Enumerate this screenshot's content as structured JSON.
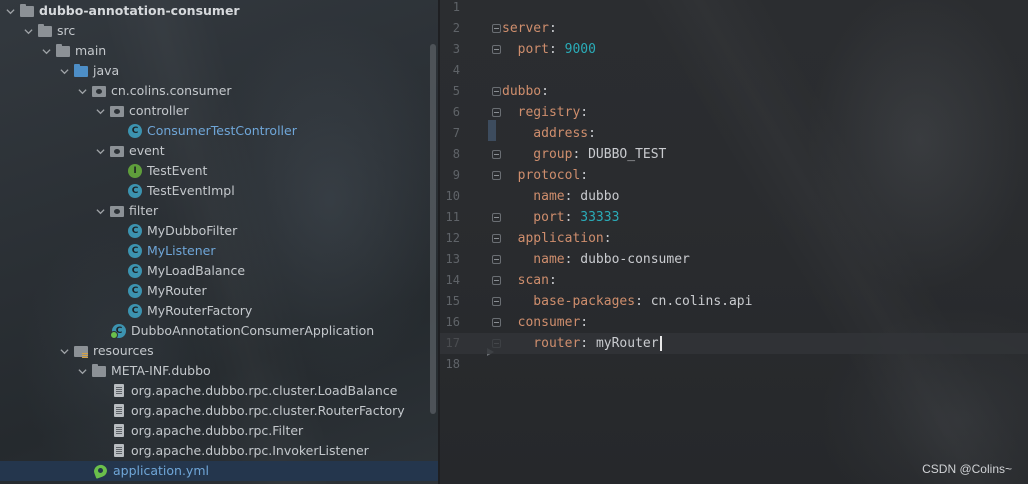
{
  "tree": {
    "items": [
      {
        "label": "dubbo-annotation-consumer",
        "icon": "folder-icon",
        "bold": true,
        "expanded": true
      },
      {
        "label": "src",
        "icon": "folder-icon",
        "expanded": true
      },
      {
        "label": "main",
        "icon": "folder-icon",
        "expanded": true
      },
      {
        "label": "java",
        "icon": "source-folder-icon",
        "expanded": true
      },
      {
        "label": "cn.colins.consumer",
        "icon": "package-icon",
        "expanded": true
      },
      {
        "label": "controller",
        "icon": "package-icon",
        "expanded": true
      },
      {
        "label": "ConsumerTestController",
        "icon": "class-icon",
        "glyph": "C"
      },
      {
        "label": "event",
        "icon": "package-icon",
        "expanded": true
      },
      {
        "label": "TestEvent",
        "icon": "interface-icon",
        "glyph": "I"
      },
      {
        "label": "TestEventImpl",
        "icon": "class-icon",
        "glyph": "C"
      },
      {
        "label": "filter",
        "icon": "package-icon",
        "expanded": true
      },
      {
        "label": "MyDubboFilter",
        "icon": "class-icon",
        "glyph": "C"
      },
      {
        "label": "MyListener",
        "icon": "class-icon",
        "glyph": "C"
      },
      {
        "label": "MyLoadBalance",
        "icon": "class-icon",
        "glyph": "C"
      },
      {
        "label": "MyRouter",
        "icon": "class-icon",
        "glyph": "C"
      },
      {
        "label": "MyRouterFactory",
        "icon": "class-icon",
        "glyph": "C"
      },
      {
        "label": "DubboAnnotationConsumerApplication",
        "icon": "spring-app-icon",
        "glyph": "C"
      },
      {
        "label": "resources",
        "icon": "resources-folder-icon",
        "expanded": true
      },
      {
        "label": "META-INF.dubbo",
        "icon": "folder-icon",
        "expanded": true
      },
      {
        "label": "org.apache.dubbo.rpc.cluster.LoadBalance",
        "icon": "file-icon"
      },
      {
        "label": "org.apache.dubbo.rpc.cluster.RouterFactory",
        "icon": "file-icon"
      },
      {
        "label": "org.apache.dubbo.rpc.Filter",
        "icon": "file-icon"
      },
      {
        "label": "org.apache.dubbo.rpc.InvokerListener",
        "icon": "file-icon"
      },
      {
        "label": "application.yml",
        "icon": "yaml-file-icon",
        "selected": true
      }
    ]
  },
  "editor": {
    "current_line": 17,
    "lines": [
      {
        "num": "1",
        "key": "",
        "sep": "",
        "val": ""
      },
      {
        "num": "2",
        "key": "server",
        "sep": ":",
        "val": ""
      },
      {
        "num": "3",
        "key": "  port",
        "sep": ": ",
        "val": "9000",
        "numeric": true
      },
      {
        "num": "4",
        "key": "",
        "sep": "",
        "val": ""
      },
      {
        "num": "5",
        "key": "dubbo",
        "sep": ":",
        "val": ""
      },
      {
        "num": "6",
        "key": "  registry",
        "sep": ":",
        "val": ""
      },
      {
        "num": "7",
        "key": "    address",
        "sep": ":",
        "val": ""
      },
      {
        "num": "8",
        "key": "    group",
        "sep": ": ",
        "val": "DUBBO_TEST"
      },
      {
        "num": "9",
        "key": "  protocol",
        "sep": ":",
        "val": ""
      },
      {
        "num": "10",
        "key": "    name",
        "sep": ": ",
        "val": "dubbo"
      },
      {
        "num": "11",
        "key": "    port",
        "sep": ": ",
        "val": "33333",
        "numeric": true
      },
      {
        "num": "12",
        "key": "  application",
        "sep": ":",
        "val": ""
      },
      {
        "num": "13",
        "key": "    name",
        "sep": ": ",
        "val": "dubbo-consumer"
      },
      {
        "num": "14",
        "key": "  scan",
        "sep": ":",
        "val": ""
      },
      {
        "num": "15",
        "key": "    base-packages",
        "sep": ": ",
        "val": "cn.colins.api"
      },
      {
        "num": "16",
        "key": "  consumer",
        "sep": ":",
        "val": ""
      },
      {
        "num": "17",
        "key": "    router",
        "sep": ": ",
        "val": "myRouter"
      },
      {
        "num": "18",
        "key": "",
        "sep": "",
        "val": ""
      }
    ]
  },
  "watermark": "CSDN @Colins~",
  "colors": {
    "keyword": "#cf8e6d",
    "number": "#2aacb8",
    "selection": "#24364d",
    "class_icon": "#3c93b0",
    "interface_icon": "#5f9e3b"
  }
}
